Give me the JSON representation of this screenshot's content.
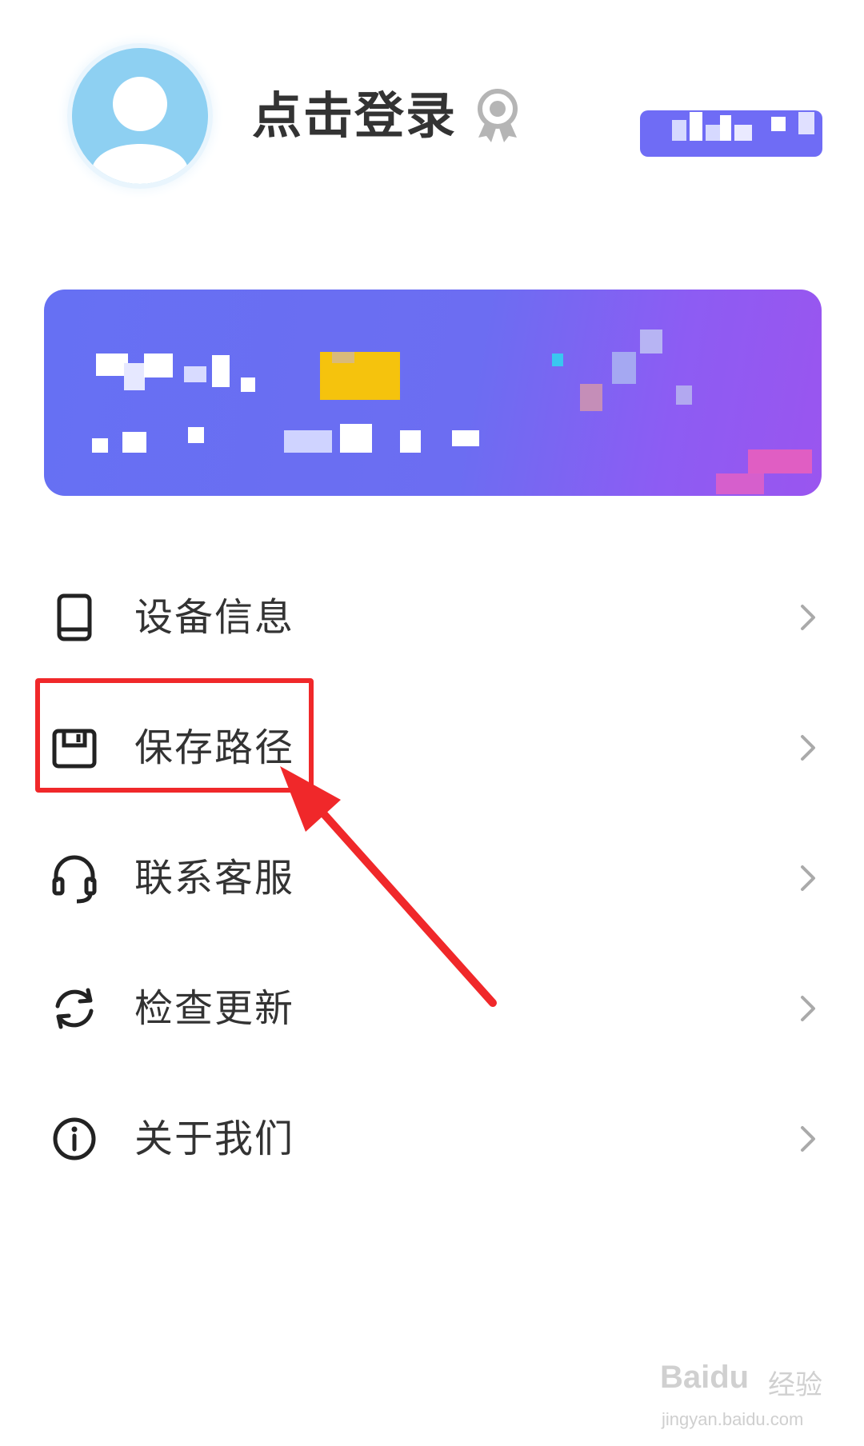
{
  "header": {
    "login_text": "点击登录",
    "avatar_icon": "default-user-avatar",
    "badge_icon": "medal-icon"
  },
  "menu": {
    "items": [
      {
        "label": "设备信息",
        "icon": "tablet-icon"
      },
      {
        "label": "保存路径",
        "icon": "floppy-disk-icon"
      },
      {
        "label": "联系客服",
        "icon": "headset-icon"
      },
      {
        "label": "检查更新",
        "icon": "refresh-icon"
      },
      {
        "label": "关于我们",
        "icon": "info-icon"
      }
    ],
    "chevron_icon": "chevron-right-icon"
  },
  "annotation": {
    "highlight_color": "#f0282a",
    "highlighted_item": "保存路径"
  },
  "watermark": {
    "brand": "Baidu",
    "cn": "经验",
    "url": "jingyan.baidu.com"
  },
  "colors": {
    "banner_start": "#6670f3",
    "banner_end": "#9a55ef",
    "vip_pill": "#6f6cf5",
    "text": "#333333"
  }
}
